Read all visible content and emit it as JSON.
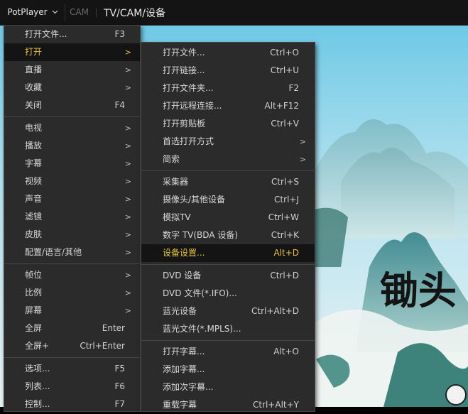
{
  "titlebar": {
    "app_name": "PotPlayer",
    "mode_label": "CAM",
    "title": "TV/CAM/设备"
  },
  "background": {
    "overlay_text": "锄头"
  },
  "main_menu": {
    "groups": [
      [
        {
          "label": "打开文件...",
          "shortcut": "F3",
          "submenu": false
        },
        {
          "label": "打开",
          "shortcut": "",
          "submenu": true,
          "highlight": true
        },
        {
          "label": "直播",
          "shortcut": "",
          "submenu": true
        },
        {
          "label": "收藏",
          "shortcut": "",
          "submenu": true
        },
        {
          "label": "关闭",
          "shortcut": "F4",
          "submenu": false
        }
      ],
      [
        {
          "label": "电视",
          "shortcut": "",
          "submenu": true
        },
        {
          "label": "播放",
          "shortcut": "",
          "submenu": true
        },
        {
          "label": "字幕",
          "shortcut": "",
          "submenu": true
        },
        {
          "label": "视频",
          "shortcut": "",
          "submenu": true
        },
        {
          "label": "声音",
          "shortcut": "",
          "submenu": true
        },
        {
          "label": "滤镜",
          "shortcut": "",
          "submenu": true
        },
        {
          "label": "皮肤",
          "shortcut": "",
          "submenu": true
        },
        {
          "label": "配置/语言/其他",
          "shortcut": "",
          "submenu": true
        }
      ],
      [
        {
          "label": "帧位",
          "shortcut": "",
          "submenu": true
        },
        {
          "label": "比例",
          "shortcut": "",
          "submenu": true
        },
        {
          "label": "屏幕",
          "shortcut": "",
          "submenu": true
        },
        {
          "label": "全屏",
          "shortcut": "Enter",
          "submenu": false
        },
        {
          "label": "全屏+",
          "shortcut": "Ctrl+Enter",
          "submenu": false
        }
      ],
      [
        {
          "label": "选项...",
          "shortcut": "F5",
          "submenu": false
        },
        {
          "label": "列表...",
          "shortcut": "F6",
          "submenu": false
        },
        {
          "label": "控制...",
          "shortcut": "F7",
          "submenu": false
        }
      ]
    ]
  },
  "sub_menu": {
    "groups": [
      [
        {
          "label": "打开文件...",
          "shortcut": "Ctrl+O",
          "submenu": false
        },
        {
          "label": "打开链接...",
          "shortcut": "Ctrl+U",
          "submenu": false
        },
        {
          "label": "打开文件夹...",
          "shortcut": "F2",
          "submenu": false
        },
        {
          "label": "打开远程连接...",
          "shortcut": "Alt+F12",
          "submenu": false
        },
        {
          "label": "打开剪贴板",
          "shortcut": "Ctrl+V",
          "submenu": false
        },
        {
          "label": "首选打开方式",
          "shortcut": "",
          "submenu": true
        },
        {
          "label": "简索",
          "shortcut": "",
          "submenu": true
        }
      ],
      [
        {
          "label": "采集器",
          "shortcut": "Ctrl+S",
          "submenu": false
        },
        {
          "label": "摄像头/其他设备",
          "shortcut": "Ctrl+J",
          "submenu": false
        },
        {
          "label": "模拟TV",
          "shortcut": "Ctrl+W",
          "submenu": false
        },
        {
          "label": "数字 TV(BDA 设备)",
          "shortcut": "Ctrl+K",
          "submenu": false
        },
        {
          "label": "设备设置...",
          "shortcut": "Alt+D",
          "submenu": false,
          "highlight": true
        }
      ],
      [
        {
          "label": "DVD 设备",
          "shortcut": "Ctrl+D",
          "submenu": false
        },
        {
          "label": "DVD 文件(*.IFO)...",
          "shortcut": "",
          "submenu": false
        },
        {
          "label": "蓝光设备",
          "shortcut": "Ctrl+Alt+D",
          "submenu": false
        },
        {
          "label": "蓝光文件(*.MPLS)...",
          "shortcut": "",
          "submenu": false
        }
      ],
      [
        {
          "label": "打开字幕...",
          "shortcut": "Alt+O",
          "submenu": false
        },
        {
          "label": "添加字幕...",
          "shortcut": "",
          "submenu": false
        },
        {
          "label": "添加次字幕...",
          "shortcut": "",
          "submenu": false
        },
        {
          "label": "重载字幕",
          "shortcut": "Ctrl+Alt+Y",
          "submenu": false
        }
      ]
    ]
  },
  "colors": {
    "menu_bg": "#2b2b2b",
    "highlight_text": "#e8c33a",
    "highlight_bg": "#141414",
    "sky": "#8fd3ea"
  }
}
